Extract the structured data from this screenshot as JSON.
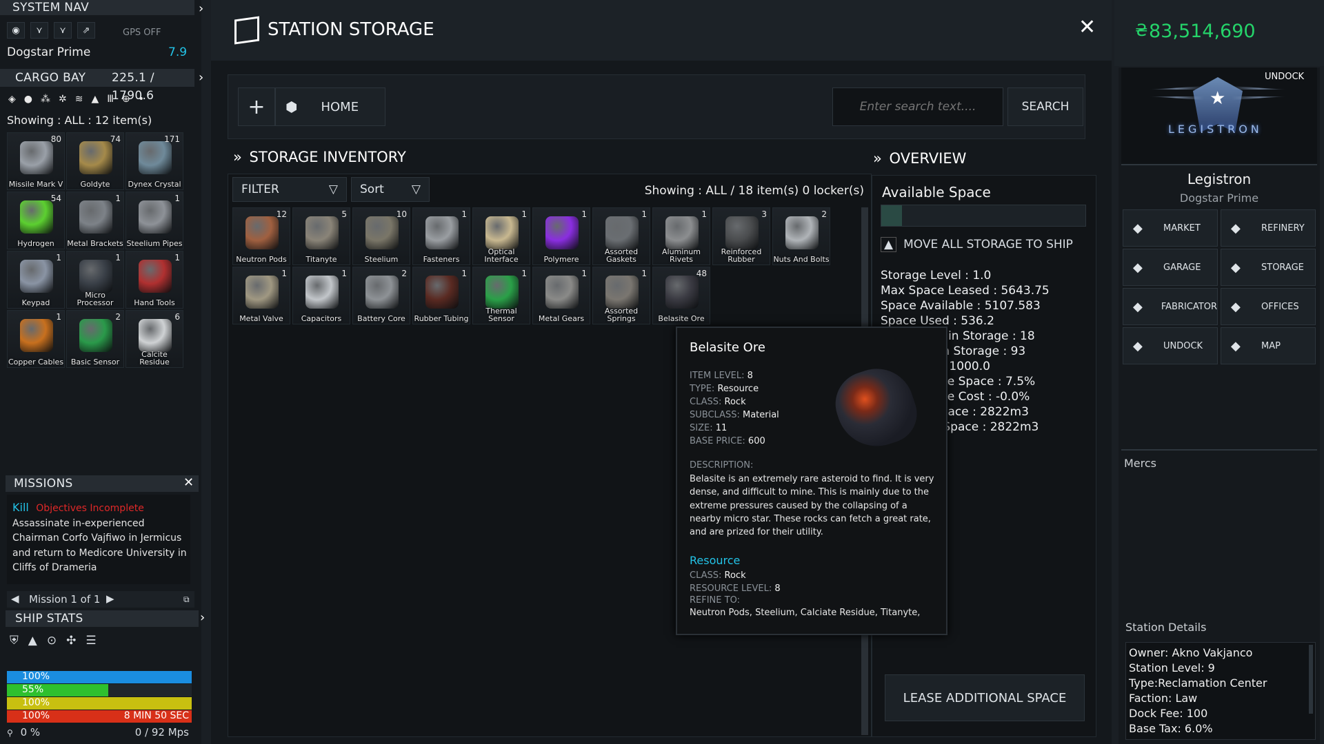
{
  "colors": {
    "accent_cyan": "#23c4e8",
    "credits_green": "#25d46a",
    "alert_red": "#e02828",
    "bar_blue": "#1a8de0",
    "bar_green": "#2ec02e",
    "bar_yellow": "#c8c010",
    "bar_red": "#d83018"
  },
  "nav": {
    "title": "SYSTEM NAV",
    "gps": "GPS OFF",
    "location": "Dogstar Prime",
    "location_value": "7.9"
  },
  "cargo": {
    "title": "CARGO BAY",
    "capacity": "225.1 / 1790.6",
    "showing": "Showing : ALL : 12 item(s)",
    "items": [
      {
        "name": "Missile Mark V",
        "qty": "80",
        "icon": "missile-icon",
        "color": "#9aa0a8"
      },
      {
        "name": "Goldyte",
        "qty": "74",
        "icon": "goldyte-ore-icon",
        "color": "#a58a4a"
      },
      {
        "name": "Dynex Crystal",
        "qty": "171",
        "icon": "crystal-icon",
        "color": "#6f8a9a"
      },
      {
        "name": "Hydrogen",
        "qty": "54",
        "icon": "hydrogen-canister-icon",
        "color": "#5cd030"
      },
      {
        "name": "Metal Brackets",
        "qty": "1",
        "icon": "brackets-icon",
        "color": "#7d8288"
      },
      {
        "name": "Steelium Pipes",
        "qty": "1",
        "icon": "pipes-icon",
        "color": "#8e9298"
      },
      {
        "name": "Keypad",
        "qty": "1",
        "icon": "keypad-icon",
        "color": "#8a94a4"
      },
      {
        "name": "Micro Processor",
        "qty": "1",
        "icon": "processor-icon",
        "color": "#3a4048"
      },
      {
        "name": "Hand Tools",
        "qty": "1",
        "icon": "tools-icon",
        "color": "#b03030"
      },
      {
        "name": "Copper Cables",
        "qty": "1",
        "icon": "cables-icon",
        "color": "#c8701e"
      },
      {
        "name": "Basic Sensor",
        "qty": "2",
        "icon": "sensor-board-icon",
        "color": "#2a9a4a"
      },
      {
        "name": "Calcite Residue",
        "qty": "6",
        "icon": "residue-icon",
        "color": "#cfd2d4"
      }
    ]
  },
  "missions": {
    "title": "MISSIONS",
    "type": "Kill",
    "status": "Objectives Incomplete",
    "text": "Assassinate in-experienced Chairman Corfo Vajfiwo in Jermicus and return to Medicore University in Cliffs of Drameria",
    "pager": "Mission 1 of 1"
  },
  "ship_stats": {
    "title": "SHIP STATS",
    "bars": [
      {
        "label": "100%",
        "fill": 1.0,
        "color": "#1a8de0",
        "right": ""
      },
      {
        "label": "55%",
        "fill": 0.55,
        "color": "#2ec02e",
        "right": ""
      },
      {
        "label": "100%",
        "fill": 1.0,
        "color": "#c8c010",
        "right": ""
      },
      {
        "label": "100%",
        "fill": 1.0,
        "color": "#d83018",
        "right": "8 MIN 50 SEC"
      }
    ],
    "speed": "0 %",
    "speed_right": "0  /  92 Mps"
  },
  "storage": {
    "title": "STATION STORAGE",
    "home_label": "HOME",
    "search_placeholder": "Enter search text....",
    "search_label": "SEARCH",
    "inventory_title": "STORAGE INVENTORY",
    "filter_label": "FILTER",
    "sort_label": "Sort",
    "showing": "Showing : ALL / 18 item(s) 0 locker(s)",
    "items": [
      {
        "name": "Neutron Pods",
        "qty": "12",
        "icon": "neutron-pods-icon",
        "color": "#a06040"
      },
      {
        "name": "Titanyte",
        "qty": "5",
        "icon": "titanyte-ore-icon",
        "color": "#8a8478"
      },
      {
        "name": "Steelium",
        "qty": "10",
        "icon": "steelium-ore-icon",
        "color": "#7a7668"
      },
      {
        "name": "Fasteners",
        "qty": "1",
        "icon": "fasteners-icon",
        "color": "#9a9ea2"
      },
      {
        "name": "Optical Interface",
        "qty": "1",
        "icon": "optical-interface-icon",
        "color": "#c8b890"
      },
      {
        "name": "Polymere",
        "qty": "1",
        "icon": "polymere-icon",
        "color": "#8a2ee0"
      },
      {
        "name": "Assorted Gaskets",
        "qty": "1",
        "icon": "gaskets-icon",
        "color": "#6a6e72"
      },
      {
        "name": "Aluminum Rivets",
        "qty": "1",
        "icon": "rivets-icon",
        "color": "#8c8e90"
      },
      {
        "name": "Reinforced Rubber",
        "qty": "3",
        "icon": "rubber-blocks-icon",
        "color": "#4a4c4e"
      },
      {
        "name": "Nuts And Bolts",
        "qty": "2",
        "icon": "nuts-bolts-icon",
        "color": "#b0b4b8"
      },
      {
        "name": "Metal Valve",
        "qty": "1",
        "icon": "valve-icon",
        "color": "#a09882"
      },
      {
        "name": "Capacitors",
        "qty": "1",
        "icon": "capacitors-icon",
        "color": "#c2c6ca"
      },
      {
        "name": "Battery Core",
        "qty": "2",
        "icon": "battery-core-icon",
        "color": "#8e9296"
      },
      {
        "name": "Rubber Tubing",
        "qty": "1",
        "icon": "tubing-icon",
        "color": "#5a2a22"
      },
      {
        "name": "Thermal Sensor",
        "qty": "1",
        "icon": "thermal-sensor-icon",
        "color": "#2aa048"
      },
      {
        "name": "Metal Gears",
        "qty": "1",
        "icon": "gears-icon",
        "color": "#8a8a88"
      },
      {
        "name": "Assorted Springs",
        "qty": "1",
        "icon": "springs-icon",
        "color": "#7a7670"
      },
      {
        "name": "Belasite Ore",
        "qty": "48",
        "icon": "belasite-ore-icon",
        "color": "#3a3a42"
      }
    ]
  },
  "tooltip": {
    "title": "Belasite Ore",
    "fields": [
      {
        "k": "ITEM LEVEL:",
        "v": "8"
      },
      {
        "k": "TYPE:",
        "v": "Resource"
      },
      {
        "k": "CLASS:",
        "v": "Rock"
      },
      {
        "k": "SUBCLASS:",
        "v": "Material"
      },
      {
        "k": "SIZE:",
        "v": "11"
      },
      {
        "k": "BASE PRICE:",
        "v": "600"
      }
    ],
    "desc_label": "DESCRIPTION:",
    "description": "Belasite is an extremely rare asteroid to find. It is very dense, and difficult to mine. This is mainly due to the extreme pressures caused by the collapsing of a nearby micro star. These rocks can fetch a great rate, and are prized for their utility.",
    "resource_title": "Resource",
    "res_fields": [
      {
        "k": "CLASS:",
        "v": "Rock"
      },
      {
        "k": "RESOURCE LEVEL:",
        "v": "8"
      }
    ],
    "refine_label": "REFINE TO:",
    "refine_to": "Neutron Pods, Steelium, Calciate Residue, Titanyte,"
  },
  "overview": {
    "title": "OVERVIEW",
    "available_label": "Available Space",
    "move_label": "MOVE ALL STORAGE TO SHIP",
    "stats": [
      "Storage Level : 1.0",
      "Max Space Leased : 5643.75",
      "Space Available : 5107.583",
      "Space Used : 536.2",
      "Total Items in Storage : 18",
      "Total QTY in Storage : 93",
      "Total Cost : 1000.0",
      "Bonus Lease Space : 7.5%",
      "Bonus Lease Cost : -0.0%",
      "Refinery Space : 2822m3",
      "Fabricator Space : 2822m3"
    ],
    "lease_label": "LEASE ADDITIONAL SPACE"
  },
  "credits": {
    "symbol": "₴",
    "amount": "83,514,690"
  },
  "station": {
    "undock_top": "UNDOCK",
    "logo_text": "LEGISTRON",
    "name": "Legistron",
    "system": "Dogstar Prime",
    "buttons": [
      {
        "label": "MARKET",
        "icon": "market-icon"
      },
      {
        "label": "REFINERY",
        "icon": "refinery-icon"
      },
      {
        "label": "GARAGE",
        "icon": "garage-icon"
      },
      {
        "label": "STORAGE",
        "icon": "storage-icon"
      },
      {
        "label": "FABRICATOR",
        "icon": "fabricator-icon"
      },
      {
        "label": "OFFICES",
        "icon": "offices-icon"
      },
      {
        "label": "UNDOCK",
        "icon": "undock-icon"
      },
      {
        "label": "MAP",
        "icon": "map-icon"
      }
    ],
    "mercs_label": "Mercs",
    "details_title": "Station Details",
    "details": [
      "Owner: Akno Vakjanco",
      "Station Level: 9",
      "Type:Reclamation Center",
      "Faction: Law",
      "Dock Fee: 100",
      "Base Tax: 6.0%"
    ]
  }
}
